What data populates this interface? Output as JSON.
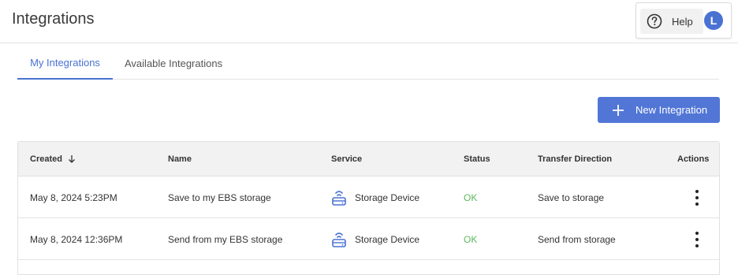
{
  "header": {
    "title": "Integrations",
    "help_label": "Help",
    "avatar_initial": "L"
  },
  "tabs": [
    {
      "label": "My Integrations",
      "active": true
    },
    {
      "label": "Available Integrations",
      "active": false
    }
  ],
  "actions": {
    "new_integration_label": "New Integration"
  },
  "table": {
    "columns": {
      "created": "Created",
      "name": "Name",
      "service": "Service",
      "status": "Status",
      "direction": "Transfer Direction",
      "actions": "Actions"
    },
    "sort": {
      "column": "created",
      "direction": "descending"
    },
    "rows": [
      {
        "created": "May 8, 2024 5:23PM",
        "name": "Save to my EBS storage",
        "service": "Storage Device",
        "status": "OK",
        "direction": "Save to storage"
      },
      {
        "created": "May 8, 2024 12:36PM",
        "name": "Send from my EBS storage",
        "service": "Storage Device",
        "status": "OK",
        "direction": "Send from storage"
      }
    ]
  },
  "icons": {
    "help": "help-circle-icon",
    "add": "plus-icon",
    "sort": "arrow-down-icon",
    "service": "storage-device-icon",
    "row_menu": "kebab-menu-icon"
  },
  "colors": {
    "accent": "#4a72d3",
    "button": "#5176d6",
    "status_ok": "#5cb85c"
  }
}
